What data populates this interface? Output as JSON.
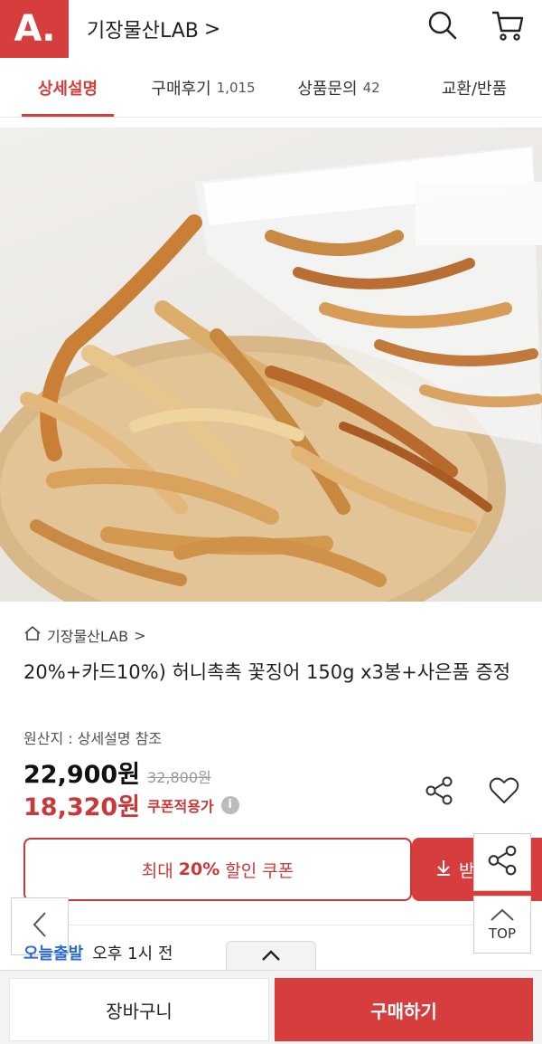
{
  "header": {
    "logo": "A.",
    "store_title": "기장물산LAB",
    "chevron": ">"
  },
  "tabs": [
    {
      "label": "상세설명",
      "count": ""
    },
    {
      "label": "구매후기",
      "count": "1,015"
    },
    {
      "label": "상품문의",
      "count": "42"
    },
    {
      "label": "교환/반품",
      "count": ""
    }
  ],
  "product": {
    "breadcrumb": "기장물산LAB",
    "breadcrumb_chevron": ">",
    "name": "20%+카드10%) 허니촉촉 꽃징어 150g x3봉+사은품 증정",
    "origin": "원산지 : 상세설명 참조",
    "price_now": "22,900원",
    "price_old": "32,800원",
    "price_sale": "18,320원",
    "coupon_applied": "쿠폰적용가",
    "info_mark": "i"
  },
  "coupon": {
    "prefix": "최대",
    "percent": "20%",
    "suffix": "할인 쿠폰",
    "button_label": "받"
  },
  "floating": {
    "top_label": "TOP"
  },
  "delivery": {
    "tag": "오늘출발",
    "time": "오후 1시 전"
  },
  "bottom": {
    "cart_label": "장바구니",
    "buy_label": "구매하기"
  },
  "colors": {
    "brand": "#d63d3d",
    "sale": "#c9383a",
    "delivery": "#2d6bd1"
  }
}
